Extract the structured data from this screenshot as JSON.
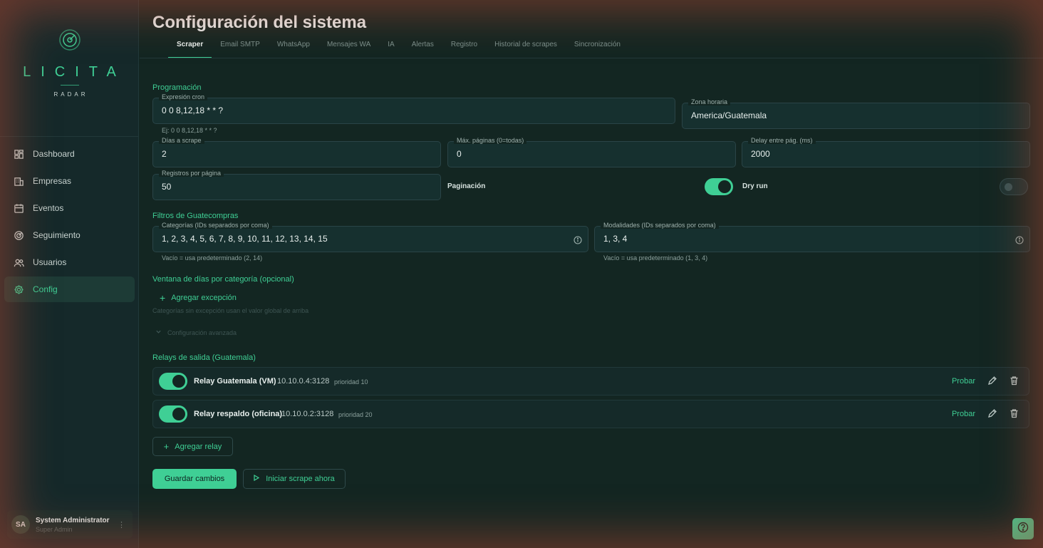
{
  "brand": {
    "word": "LICITA",
    "sub": "RADAR"
  },
  "sidebar": {
    "items": [
      {
        "label": "Dashboard",
        "icon": "dashboard-icon"
      },
      {
        "label": "Empresas",
        "icon": "building-icon"
      },
      {
        "label": "Eventos",
        "icon": "calendar-icon"
      },
      {
        "label": "Seguimiento",
        "icon": "radar-icon"
      },
      {
        "label": "Usuarios",
        "icon": "users-icon"
      },
      {
        "label": "Config",
        "icon": "gear-icon",
        "active": true
      }
    ],
    "user": {
      "initials": "SA",
      "name": "System Administrator",
      "role": "Super Admin"
    }
  },
  "header": {
    "title": "Configuración del sistema"
  },
  "tabs": [
    {
      "label": "Scraper",
      "active": true
    },
    {
      "label": "Email SMTP"
    },
    {
      "label": "WhatsApp"
    },
    {
      "label": "Mensajes WA"
    },
    {
      "label": "IA"
    },
    {
      "label": "Alertas"
    },
    {
      "label": "Registro"
    },
    {
      "label": "Historial de scrapes"
    },
    {
      "label": "Sincronización"
    }
  ],
  "programacion": {
    "title": "Programación",
    "cron": {
      "label": "Expresión cron",
      "value": "0 0 8,12,18 * * ?",
      "hint": "Ej: 0 0 8,12,18 * * ?"
    },
    "timezone": {
      "label": "Zona horaria",
      "value": "America/Guatemala"
    },
    "days": {
      "label": "Días a scrape",
      "value": "2"
    },
    "max_pages": {
      "label": "Máx. páginas (0=todas)",
      "value": "0"
    },
    "delay": {
      "label": "Delay entre pág. (ms)",
      "value": "2000"
    },
    "per_page": {
      "label": "Registros por página",
      "value": "50"
    },
    "pagination": {
      "label": "Paginación",
      "on": true
    },
    "dry_run": {
      "label": "Dry run",
      "on": false
    }
  },
  "filtros": {
    "title": "Filtros de Guatecompras",
    "categorias": {
      "label": "Categorías (IDs separados por coma)",
      "value": "1, 2, 3, 4, 5, 6, 7, 8, 9, 10, 11, 12, 13, 14, 15",
      "hint": "Vacío = usa predeterminado (2, 14)"
    },
    "modalidades": {
      "label": "Modalidades (IDs separados por coma)",
      "value": "1, 3, 4",
      "hint": "Vacío = usa predeterminado (1, 3, 4)"
    }
  },
  "ventana": {
    "title": "Ventana de días por categoría (opcional)",
    "add_label": "Agregar excepción",
    "note": "Categorías sin excepción usan el valor global de arriba",
    "advanced_label": "Configuración avanzada"
  },
  "relays": {
    "title": "Relays de salida (Guatemala)",
    "items": [
      {
        "name": "Relay Guatemala (VM)",
        "address": "10.10.0.4:3128",
        "priority": "prioridad 10",
        "test": "Probar",
        "on": true
      },
      {
        "name": "Relay respaldo (oficina)",
        "address": "10.10.0.2:3128",
        "priority": "prioridad 20",
        "test": "Probar",
        "on": true
      }
    ],
    "add_label": "Agregar relay"
  },
  "actions": {
    "save": "Guardar cambios",
    "run": "Iniciar scrape ahora"
  },
  "colors": {
    "accent": "#3fcf95",
    "background": "#132622"
  }
}
